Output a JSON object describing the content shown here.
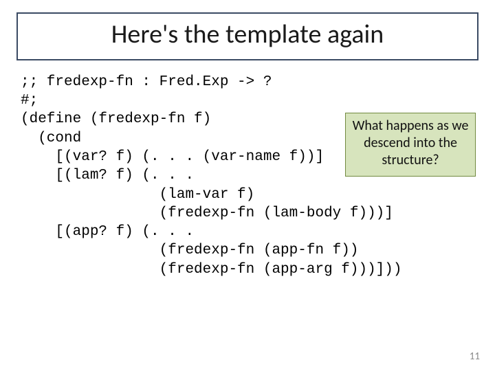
{
  "title": "Here's the template again",
  "code": ";; fredexp-fn : Fred.Exp -> ?\n#;\n(define (fredexp-fn f)\n  (cond\n    [(var? f) (. . . (var-name f))]\n    [(lam? f) (. . .\n                (lam-var f)\n                (fredexp-fn (lam-body f)))]\n    [(app? f) (. . .\n                (fredexp-fn (app-fn f))\n                (fredexp-fn (app-arg f)))]))",
  "callout": "What happens as we descend into the structure?",
  "page_number": "11"
}
